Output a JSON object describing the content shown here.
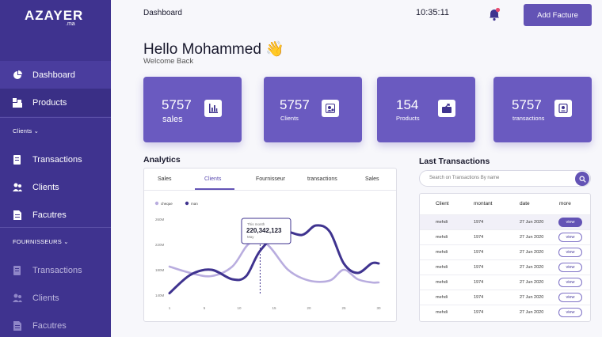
{
  "sidebar": {
    "logo": "AZAYER",
    "logo_sub": ".ma",
    "items_top": [
      {
        "label": "Dashboard"
      },
      {
        "label": "Products"
      }
    ],
    "clients_section": "Clients",
    "clients_items": [
      {
        "label": "Transactions"
      },
      {
        "label": "Clients"
      },
      {
        "label": "Facutres"
      }
    ],
    "fournisseurs_section": "FOURNISSEURS",
    "fournisseurs_items": [
      {
        "label": "Transactions"
      },
      {
        "label": "Clients"
      },
      {
        "label": "Facutres"
      }
    ]
  },
  "header": {
    "title": "Dashboard",
    "clock": "10:35:11",
    "add_button": "Add Facture"
  },
  "greeting": {
    "hello": "Hello Mohammed",
    "emoji": "👋",
    "welcome": "Welcome Back"
  },
  "stats": [
    {
      "value": "5757",
      "label": "sales"
    },
    {
      "value": "5757",
      "label": "Clients"
    },
    {
      "value": "154",
      "label": "Products"
    },
    {
      "value": "5757",
      "label": "transactions"
    }
  ],
  "analytics": {
    "title": "Analytics",
    "tabs": [
      "Sales",
      "Clients",
      "Fournisseur",
      "transactions",
      "Sales"
    ],
    "active_tab": 1,
    "legend": [
      "cheque",
      "man"
    ],
    "tooltip": {
      "label": "This month",
      "value": "220,342,123",
      "sub": "May"
    }
  },
  "chart_data": {
    "type": "line",
    "x_ticks": [
      "1",
      "5",
      "10",
      "15",
      "20",
      "25",
      "30"
    ],
    "y_ticks": [
      "260M",
      "220M",
      "180M",
      "140M"
    ],
    "ylim": [
      140,
      260
    ],
    "series": [
      {
        "name": "cheque",
        "color": "#b9addf",
        "x": [
          0,
          3,
          6,
          9,
          11.5,
          14,
          17,
          20,
          23,
          25,
          27,
          29,
          30
        ],
        "y": [
          185,
          175,
          170,
          185,
          222,
          220,
          180,
          163,
          163,
          180,
          165,
          160,
          160
        ]
      },
      {
        "name": "man",
        "color": "#3f338f",
        "x": [
          0,
          3,
          6,
          9,
          11,
          13,
          16,
          19,
          21,
          23,
          25,
          27,
          29,
          30
        ],
        "y": [
          143,
          172,
          180,
          165,
          170,
          210,
          240,
          235,
          250,
          240,
          190,
          175,
          190,
          190
        ]
      }
    ],
    "marker_x": 13
  },
  "transactions": {
    "title": "Last Transactions",
    "search_placeholder": "Search on Transactions By name",
    "columns": [
      "Client",
      "montant",
      "date",
      "more"
    ],
    "rows": [
      {
        "client": "mehdi",
        "montant": "1974",
        "date": "27 Jun 2020",
        "more": "view"
      },
      {
        "client": "mehdi",
        "montant": "1974",
        "date": "27 Jun 2020",
        "more": "view"
      },
      {
        "client": "mehdi",
        "montant": "1974",
        "date": "27 Jun 2020",
        "more": "view"
      },
      {
        "client": "mehdi",
        "montant": "1974",
        "date": "27 Jun 2020",
        "more": "view"
      },
      {
        "client": "mehdi",
        "montant": "1974",
        "date": "27 Jun 2020",
        "more": "view"
      },
      {
        "client": "mehdi",
        "montant": "1974",
        "date": "27 Jun 2020",
        "more": "view"
      },
      {
        "client": "mehdi",
        "montant": "1974",
        "date": "27 Jun 2020",
        "more": "view"
      }
    ]
  }
}
